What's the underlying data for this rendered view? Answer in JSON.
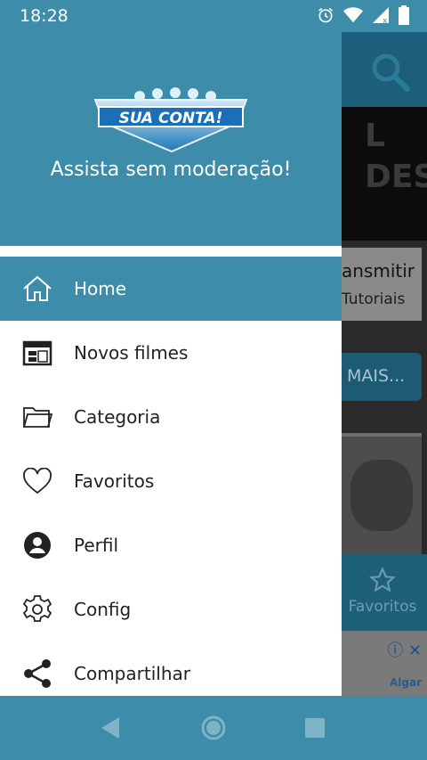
{
  "status_bar": {
    "time": "18:28",
    "icons": [
      "alarm-icon",
      "wifi-icon",
      "signal-icon",
      "battery-icon"
    ]
  },
  "background_app": {
    "hero_text": "L\nDES",
    "card_title": "ansmitir",
    "card_subtitle": "Tutoriais",
    "more_button": "MAIS...",
    "bottom_tab": "Favoritos",
    "ad_brand": "Algar"
  },
  "drawer": {
    "logo_text": "SUA CONTA!",
    "tagline": "Assista sem moderação!",
    "items": [
      {
        "label": "Home",
        "icon": "home-icon",
        "active": true
      },
      {
        "label": "Novos filmes",
        "icon": "calendar-icon",
        "active": false
      },
      {
        "label": "Categoria",
        "icon": "folder-icon",
        "active": false
      },
      {
        "label": "Favoritos",
        "icon": "heart-icon",
        "active": false
      },
      {
        "label": "Perfil",
        "icon": "account-icon",
        "active": false
      },
      {
        "label": "Config",
        "icon": "gear-icon",
        "active": false
      },
      {
        "label": "Compartilhar",
        "icon": "share-icon",
        "active": false
      }
    ]
  },
  "nav_bar": {
    "buttons": [
      "back-icon",
      "home-circle-icon",
      "recents-icon"
    ]
  },
  "colors": {
    "primary": "#3d8caa",
    "header": "#3d8caa"
  }
}
